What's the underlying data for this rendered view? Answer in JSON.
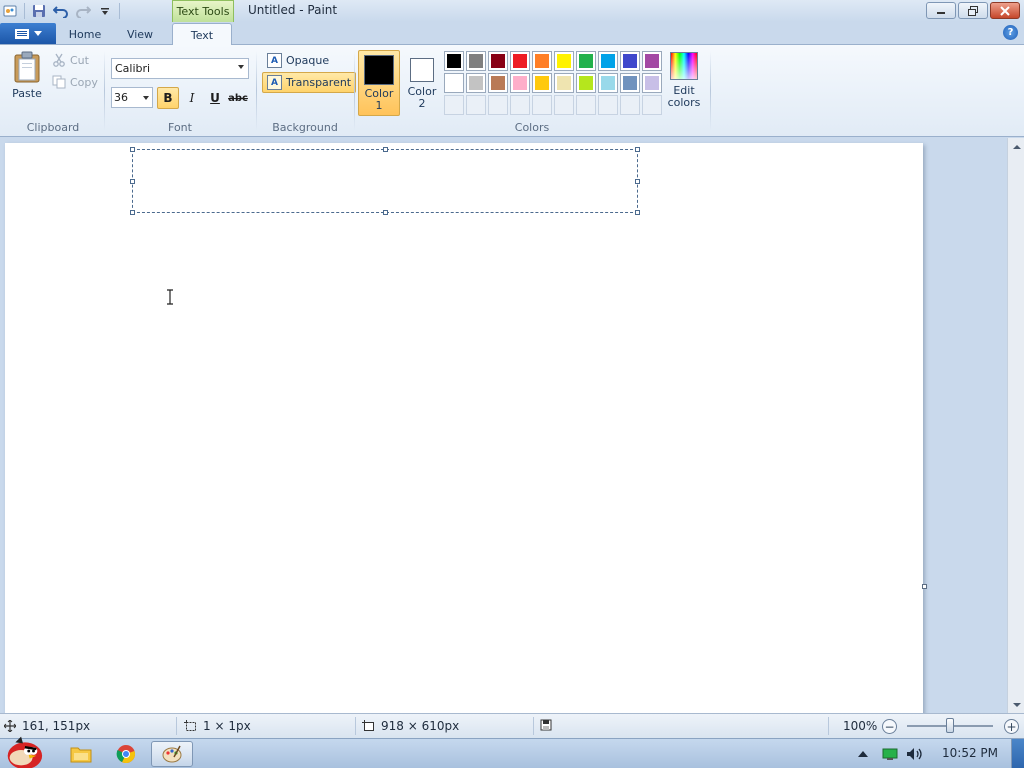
{
  "window": {
    "title": "Untitled - Paint",
    "contextual_tab": "Text Tools"
  },
  "tabs": [
    {
      "label": "Home"
    },
    {
      "label": "View"
    },
    {
      "label": "Text"
    }
  ],
  "help_label": "?",
  "clipboard": {
    "paste_label": "Paste",
    "cut_label": "Cut",
    "copy_label": "Copy",
    "group_label": "Clipboard"
  },
  "font": {
    "family": "Calibri",
    "size": "36",
    "bold_label": "B",
    "italic_label": "I",
    "underline_label": "U",
    "strike_label": "abc",
    "group_label": "Font"
  },
  "background": {
    "opaque_label": "Opaque",
    "transparent_label": "Transparent",
    "icon_letter": "A",
    "group_label": "Background"
  },
  "colors": {
    "color1_label": "Color",
    "color1_num": "1",
    "color2_label": "Color",
    "color2_num": "2",
    "color1_value": "#000000",
    "color2_value": "#ffffff",
    "edit_label_1": "Edit",
    "edit_label_2": "colors",
    "group_label": "Colors",
    "palette_row1": [
      "#000000",
      "#7f7f7f",
      "#880015",
      "#ed1c24",
      "#ff7f27",
      "#fff200",
      "#22b14c",
      "#00a2e8",
      "#3f48cc",
      "#a349a4"
    ],
    "palette_row2": [
      "#ffffff",
      "#c3c3c3",
      "#b97a57",
      "#ffaec9",
      "#ffc90e",
      "#efe4b0",
      "#b5e61d",
      "#99d9ea",
      "#7092be",
      "#c8bfe7"
    ]
  },
  "status": {
    "cursor_pos": "161, 151px",
    "selection_size": "1 × 1px",
    "canvas_size": "918 × 610px",
    "zoom": "100%",
    "zoom_out_label": "−",
    "zoom_in_label": "+",
    "zoom_level": 0.5
  },
  "taskbar": {
    "clock": "10:52 PM"
  }
}
